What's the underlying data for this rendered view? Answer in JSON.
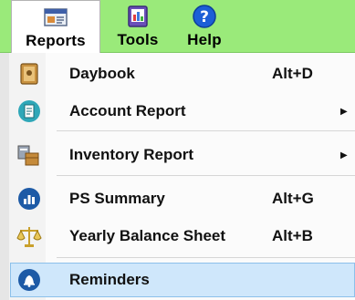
{
  "menubar": {
    "tabs": [
      {
        "label": "Reports",
        "icon": "reports-icon"
      },
      {
        "label": "Tools",
        "icon": "tools-icon"
      },
      {
        "label": "Help",
        "icon": "help-icon"
      }
    ]
  },
  "menu": {
    "items": [
      {
        "label": "Daybook",
        "shortcut": "Alt+D",
        "icon": "daybook-icon"
      },
      {
        "label": "Account Report",
        "shortcut": "",
        "submenu": true,
        "icon": "account-report-icon"
      },
      {
        "label": "Inventory Report",
        "shortcut": "",
        "submenu": true,
        "icon": "inventory-report-icon"
      },
      {
        "label": "PS Summary",
        "shortcut": "Alt+G",
        "icon": "ps-summary-icon"
      },
      {
        "label": "Yearly Balance Sheet",
        "shortcut": "Alt+B",
        "icon": "balance-scale-icon"
      },
      {
        "label": "Reminders",
        "shortcut": "",
        "highlighted": true,
        "icon": "reminders-bell-icon"
      }
    ],
    "submenu_arrow": "▶"
  },
  "colors": {
    "menubar_bg": "#9aea7a",
    "highlight_bg": "#cfe7fb",
    "highlight_border": "#8cc0ea"
  }
}
